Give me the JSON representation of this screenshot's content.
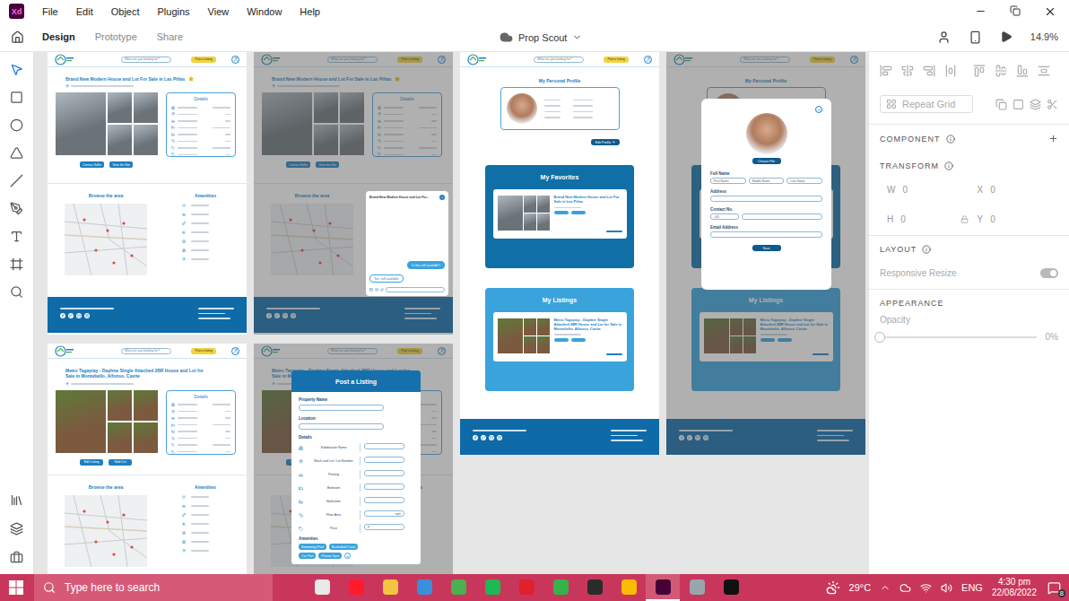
{
  "app": {
    "logo": "Xd",
    "menu": [
      "File",
      "Edit",
      "Object",
      "Plugins",
      "View",
      "Window",
      "Help"
    ]
  },
  "modebar": {
    "tabs": [
      {
        "label": "Design",
        "selected": true
      },
      {
        "label": "Prototype",
        "selected": false
      },
      {
        "label": "Share",
        "selected": false
      }
    ],
    "document": "Prop Scout",
    "zoom": "14.9%"
  },
  "tools": [
    {
      "kind": "select",
      "selected": true
    },
    {
      "kind": "rectangle",
      "selected": false
    },
    {
      "kind": "ellipse",
      "selected": false
    },
    {
      "kind": "polygon",
      "selected": false
    },
    {
      "kind": "line",
      "selected": false
    },
    {
      "kind": "pen",
      "selected": false
    },
    {
      "kind": "text",
      "selected": false
    },
    {
      "kind": "artboard",
      "selected": false
    },
    {
      "kind": "zoom",
      "selected": false
    }
  ],
  "panels": [
    {
      "kind": "assets",
      "selected": false
    },
    {
      "kind": "layers",
      "selected": false
    },
    {
      "kind": "plugins",
      "selected": false
    }
  ],
  "site": {
    "search_placeholder": "What are you looking for?",
    "post_button": "Post a listing",
    "details_title": "Details",
    "browse_title": "Browse the area",
    "amenities_title": "Amenities"
  },
  "listings": [
    {
      "title": "Brand New Modern House and Lot For Sale in Las Piñas",
      "starred": true,
      "color": "#6b7379",
      "accent": "#aeb8bf",
      "actions": [
        "Contact Seller",
        "View the Site"
      ]
    },
    {
      "title": "Metro Tagaytay - Daphne Single Attached 2BR House and Lot for Sale in Montebello, Alfonso, Cavite",
      "starred": false,
      "color": "#7b5a3f",
      "accent": "#5d7a3a",
      "actions": [
        "Edit Listing",
        "Sold Out"
      ]
    }
  ],
  "chat": {
    "title": "Brand New Modern House and Lot For...",
    "messages": [
      {
        "text": "Is this still available?",
        "mine": true
      },
      {
        "text": "Yes, still available",
        "mine": false
      }
    ]
  },
  "post_form": {
    "title": "Post a Listing",
    "fields": [
      "Property Name",
      "Location"
    ],
    "details_title": "Details",
    "details": [
      {
        "label": "Subdivision Name",
        "kind": "text",
        "affix": ""
      },
      {
        "label": "Block and Lot / Lot Number",
        "kind": "text",
        "affix": ""
      },
      {
        "label": "Parking",
        "kind": "text",
        "affix": ""
      },
      {
        "label": "Bedroom",
        "kind": "text",
        "affix": ""
      },
      {
        "label": "Bathroom",
        "kind": "text",
        "affix": ""
      },
      {
        "label": "Floor Area",
        "kind": "suffix",
        "affix": "sqm"
      },
      {
        "label": "Price",
        "kind": "prefix",
        "affix": "₱"
      }
    ],
    "amenities_title": "Amenities",
    "amenities": [
      "Swimming Pool",
      "Basketball Court",
      "Car Port",
      "Private Gym"
    ],
    "add": "+"
  },
  "profile": {
    "title": "My Personal Profile",
    "edit_button": "Edit Profile",
    "favorites_title": "My Favorites",
    "favorite_listing": 0,
    "listings_title": "My Listings",
    "my_listing": 1
  },
  "edit_profile": {
    "choose_file": "Choose File",
    "fields": [
      {
        "label": "Full Name",
        "inputs": [
          "First Name",
          "Middle Name",
          "Last Name"
        ]
      },
      {
        "label": "Address",
        "inputs": [
          ""
        ]
      },
      {
        "label": "Contact No.",
        "inputs": [
          "+63",
          ""
        ]
      },
      {
        "label": "Email Address",
        "inputs": [
          ""
        ]
      }
    ],
    "save": "Save"
  },
  "inspector": {
    "repeat_grid": "Repeat Grid",
    "component": "COMPONENT",
    "transform": "TRANSFORM",
    "fields": [
      {
        "label": "W",
        "value": "0"
      },
      {
        "label": "X",
        "value": "0"
      },
      {
        "label": "H",
        "value": "0"
      },
      {
        "label": "Y",
        "value": "0"
      }
    ],
    "layout": "LAYOUT",
    "responsive": {
      "label": "Responsive Resize",
      "on": true
    },
    "appearance": "APPEARANCE",
    "opacity": {
      "label": "Opacity",
      "level": 0,
      "reading": "0%"
    }
  },
  "taskbar": {
    "search": "Type here to search",
    "apps": [
      {
        "color": "#e9e9e9",
        "selected": false
      },
      {
        "color": "#ff1b2d",
        "selected": false
      },
      {
        "color": "#f4c542",
        "selected": false
      },
      {
        "color": "#3b8fd9",
        "selected": false
      },
      {
        "color": "#4caf50",
        "selected": false
      },
      {
        "color": "#1db954",
        "selected": false
      },
      {
        "color": "#e0202c",
        "selected": false
      },
      {
        "color": "#35b34a",
        "selected": false
      },
      {
        "color": "#2b2b2b",
        "selected": false
      },
      {
        "color": "#fbbc05",
        "selected": false
      },
      {
        "color": "#470137",
        "selected": true
      },
      {
        "color": "#9aa5ad",
        "selected": false
      },
      {
        "color": "#111111",
        "selected": false
      }
    ],
    "weather": "29°C",
    "language": "ENG",
    "time": "4:30 pm",
    "date": "22/08/2022",
    "notifications": "8"
  }
}
